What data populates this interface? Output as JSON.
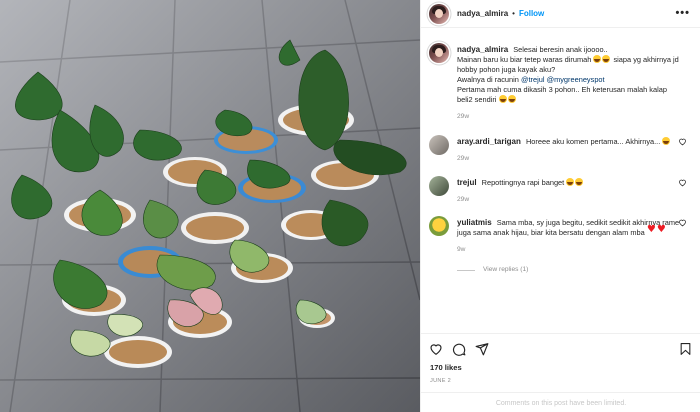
{
  "post": {
    "username": "nadya_almira",
    "follow_label": "Follow",
    "more_label": "•••"
  },
  "caption": {
    "username": "nadya_almira",
    "text_1": "Selesai beresin anak ijoooo..",
    "text_2": "Mainan baru ku biar tetep waras dirumah",
    "text_3": "siapa yg akhirnya jd hobby pohon juga kayak aku?",
    "text_4": "Awalnya di racunin",
    "mention_1": "@trejul",
    "mention_2": "@mygreeneyspot",
    "text_5": "Pertama mah cuma dikasih 3 pohon.. Eh keterusan malah kalap beli2 sendiri",
    "time": "29w"
  },
  "comments": [
    {
      "username": "aray.ardi_tarigan",
      "text": "Horeee aku komen pertama... Akhirnya...",
      "time": "29w"
    },
    {
      "username": "trejul",
      "text": "Repottingnya rapi banget",
      "time": "29w"
    },
    {
      "username": "yuliatmis",
      "text": "Sama mba, sy juga begitu, sedikit sedikit akhirnya rame juga sama anak hijau, biar kita bersatu dengan alam mba",
      "time": "9w",
      "view_replies": "View replies (1)"
    }
  ],
  "footer": {
    "likes": "170 likes",
    "date": "JUNE 2",
    "comments_limited": "Comments on this post have been limited."
  },
  "icons": [
    "more-options-icon",
    "like-heart-icon",
    "comment-icon",
    "share-icon",
    "bookmark-icon",
    "comment-like-icon"
  ],
  "colors": {
    "link": "#0095f6",
    "mention": "#00376b",
    "muted": "#8e8e8e",
    "emoji_heart": "#ed1c24"
  }
}
